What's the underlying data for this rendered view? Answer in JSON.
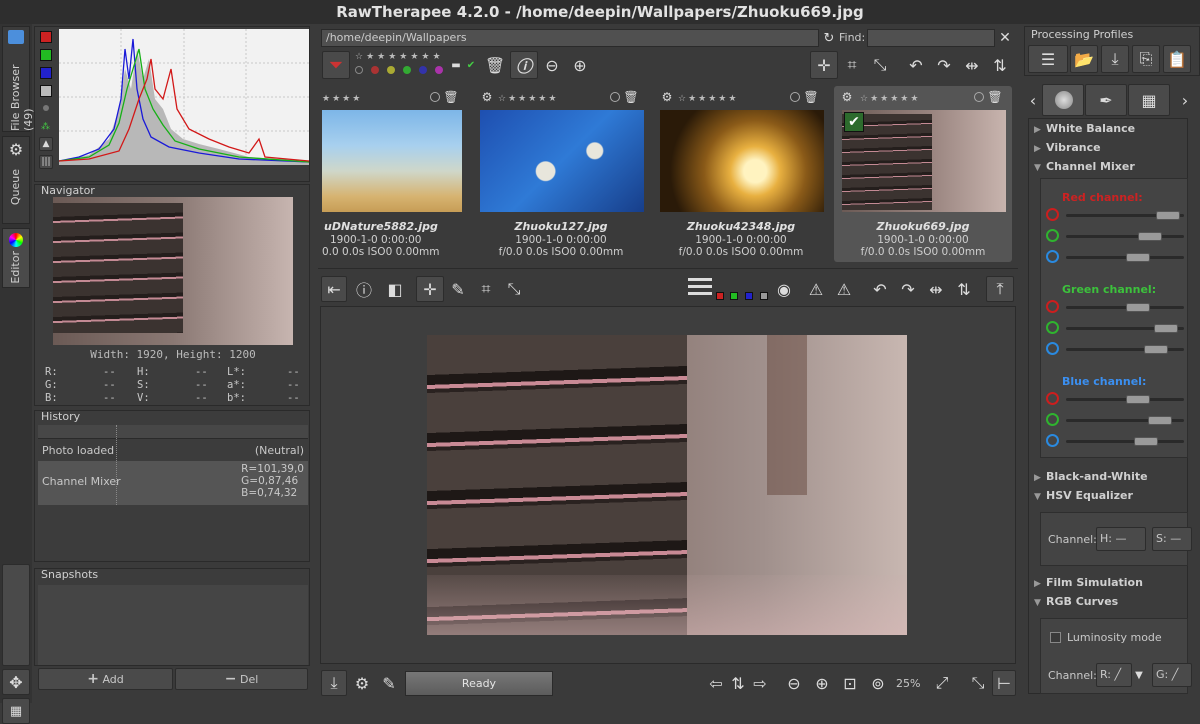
{
  "window": {
    "title": "RawTherapee 4.2.0 - /home/deepin/Wallpapers/Zhuoku669.jpg"
  },
  "side_tabs": {
    "file_browser": "File Browser (49)",
    "queue": "Queue",
    "editor": "Editor"
  },
  "navigator": {
    "title": "Navigator",
    "size": "Width: 1920, Height: 1200",
    "r_label": "R:",
    "g_label": "G:",
    "b_label": "B:",
    "h_label": "H:",
    "s_label": "S:",
    "v_label": "V:",
    "l_label": "L*:",
    "a_label": "a*:",
    "bs_label": "b*:",
    "empty": "--"
  },
  "history": {
    "title": "History",
    "rows": [
      {
        "label": "Photo loaded",
        "value": "(Neutral)"
      },
      {
        "label": "Channel Mixer",
        "value": "R=101,39,0\nG=0,87,46\nB=0,74,32"
      }
    ]
  },
  "snapshots": {
    "title": "Snapshots",
    "add": "Add",
    "del": "Del"
  },
  "browser": {
    "path": "/home/deepin/Wallpapers",
    "find_label": "Find:",
    "find_value": ""
  },
  "thumbnails": [
    {
      "name": "uDNature5882.jpg",
      "date": "1900-1-0 0:00:00",
      "exif": "0.0 0.0s ISO0 0.00mm"
    },
    {
      "name": "Zhuoku127.jpg",
      "date": "1900-1-0 0:00:00",
      "exif": "f/0.0 0.0s ISO0 0.00mm"
    },
    {
      "name": "Zhuoku42348.jpg",
      "date": "1900-1-0 0:00:00",
      "exif": "f/0.0 0.0s ISO0 0.00mm"
    },
    {
      "name": "Zhuoku669.jpg",
      "date": "1900-1-0 0:00:00",
      "exif": "f/0.0 0.0s ISO0 0.00mm"
    }
  ],
  "status": {
    "text": "Ready",
    "zoom": "25%"
  },
  "right_panel": {
    "title": "Processing Profiles",
    "sections": {
      "white_balance": "White Balance",
      "vibrance": "Vibrance",
      "channel_mixer": "Channel Mixer",
      "bw": "Black-and-White",
      "hsv": "HSV Equalizer",
      "film": "Film Simulation",
      "rgb": "RGB Curves"
    },
    "red_channel": "Red channel:",
    "green_channel": "Green channel:",
    "blue_channel": "Blue channel:",
    "channel_label": "Channel:",
    "hsv_h": "H:",
    "hsv_s": "S:",
    "rgb_r": "R:",
    "rgb_g": "G:",
    "luminosity": "Luminosity mode"
  },
  "colors": {
    "red": "#cc1e1e",
    "green": "#2fb32f",
    "blue": "#2a8ae0",
    "label_red": "#cc2222",
    "label_green": "#3cc23c",
    "label_blue": "#3b8ff0"
  }
}
